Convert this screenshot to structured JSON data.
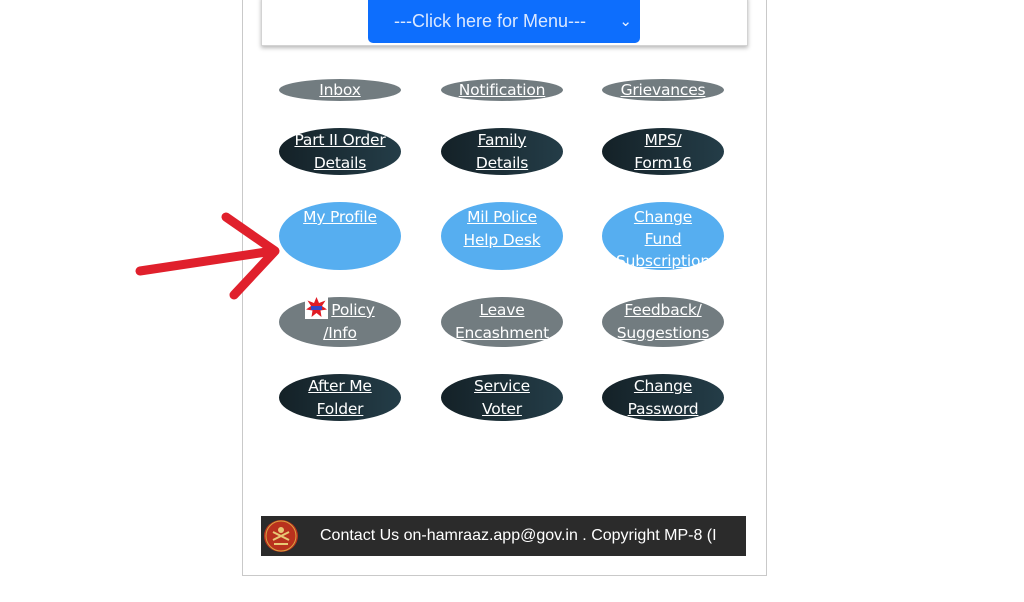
{
  "menu": {
    "select_label": "---Click here for Menu---",
    "chevron": "⌄"
  },
  "tiles": {
    "inbox": "Inbox",
    "notification": "Notification",
    "grievances": "Grievances",
    "part2_l1": "Part II Order",
    "part2_l2": "Details",
    "family_l1": "Family",
    "family_l2": "Details",
    "mps_l1": "MPS/",
    "mps_l2": "Form16",
    "my_profile": "My Profile",
    "mil_police_l1": "Mil Police",
    "mil_police_l2": "Help Desk",
    "change_fund_l1": "Change",
    "change_fund_l2": "Fund",
    "change_fund_l3": "Subscription",
    "policy_l1": "Policy",
    "policy_l2": "/Info",
    "leave_l1": "Leave",
    "leave_l2": "Encashment",
    "feedback_l1": "Feedback/",
    "feedback_l2": "Suggestions",
    "after_me_l1": "After Me",
    "after_me_l2": "Folder",
    "service_voter_l1": "Service",
    "service_voter_l2": "Voter",
    "change_password_l1": "Change",
    "change_password_l2": "Password"
  },
  "footer": {
    "text": "Contact Us on-hamraaz.app@gov.in . Copyright MP-8 (I"
  },
  "colors": {
    "menu_blue": "#0d6efd",
    "tile_grey": "#727c80",
    "tile_dark": "#1b2e36",
    "tile_blue": "#56aef0",
    "arrow_red": "#e0202c",
    "footer_bg": "#2b2b2b"
  },
  "icons": {
    "policy": "new-badge-icon",
    "annotation": "red-arrow-icon",
    "footer": "hamraaz-logo-icon"
  }
}
